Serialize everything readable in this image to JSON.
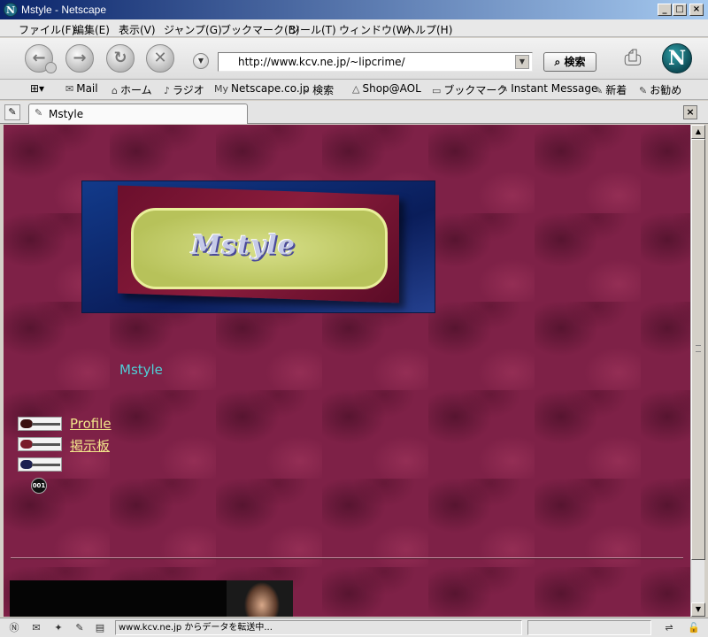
{
  "window": {
    "title": "Mstyle - Netscape",
    "controls": [
      "_",
      "□",
      "×"
    ]
  },
  "menu": [
    "ファイル(F)",
    "編集(E)",
    "表示(V)",
    "ジャンプ(G)",
    "ブックマーク(B)",
    "ツール(T)",
    "ウィンドウ(W)",
    "ヘルプ(H)"
  ],
  "navigation": {
    "url": "http://www.kcv.ne.jp/~lipcrime/",
    "search_label": "検索"
  },
  "personal_toolbar": [
    {
      "icon": "mail-icon",
      "glyph": "✉",
      "label": "Mail"
    },
    {
      "icon": "home-icon",
      "glyph": "⌂",
      "label": "ホーム"
    },
    {
      "icon": "radio-icon",
      "glyph": "♪",
      "label": "ラジオ"
    },
    {
      "icon": "my-netscape-icon",
      "glyph": "My",
      "label": "Netscape.co.jp"
    },
    {
      "icon": "search-icon",
      "glyph": "⌕",
      "label": "検索"
    },
    {
      "icon": "aol-icon",
      "glyph": "△",
      "label": "Shop@AOL"
    },
    {
      "icon": "folder-icon",
      "glyph": "▭",
      "label": "ブックマーク"
    },
    {
      "icon": "bookmark-icon",
      "glyph": "✎",
      "label": "Instant Message"
    },
    {
      "icon": "bookmark-icon",
      "glyph": "✎",
      "label": "新着"
    },
    {
      "icon": "bookmark-icon",
      "glyph": "✎",
      "label": "お勧め"
    }
  ],
  "tab": {
    "label": "Mstyle"
  },
  "page": {
    "banner_text": "Mstyle",
    "site_name": "Mstyle",
    "links": [
      {
        "label": "Profile",
        "guitar_color": "#3a1010"
      },
      {
        "label": "掲示板",
        "guitar_color": "#7a1c2a"
      },
      {
        "label": "",
        "guitar_color": "#1c2050"
      }
    ]
  },
  "status": {
    "text": "www.kcv.ne.jp からデータを転送中..."
  }
}
